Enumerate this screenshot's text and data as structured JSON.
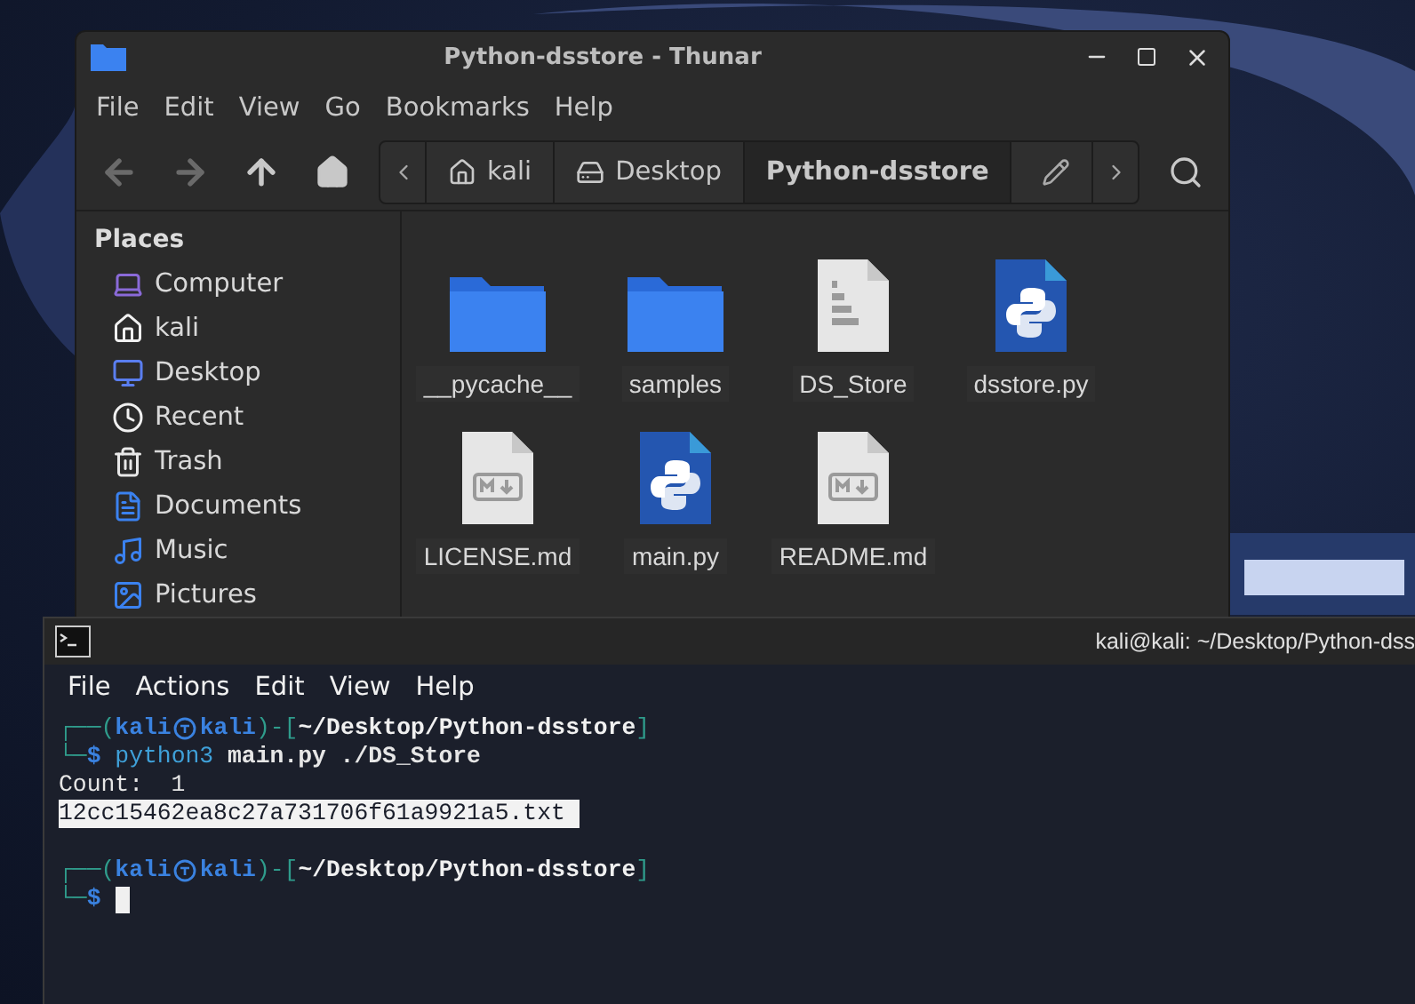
{
  "file_manager": {
    "title": "Python-dsstore - Thunar",
    "menu": [
      "File",
      "Edit",
      "View",
      "Go",
      "Bookmarks",
      "Help"
    ],
    "path": [
      {
        "label": "kali",
        "kind": "home",
        "selected": false
      },
      {
        "label": "Desktop",
        "kind": "desktop",
        "selected": false
      },
      {
        "label": "Python-dsstore",
        "kind": "folder",
        "selected": true
      }
    ],
    "sidebar": {
      "heading": "Places",
      "items": [
        {
          "label": "Computer",
          "kind": "computer"
        },
        {
          "label": "kali",
          "kind": "home"
        },
        {
          "label": "Desktop",
          "kind": "desktop"
        },
        {
          "label": "Recent",
          "kind": "recent"
        },
        {
          "label": "Trash",
          "kind": "trash"
        },
        {
          "label": "Documents",
          "kind": "documents"
        },
        {
          "label": "Music",
          "kind": "music"
        },
        {
          "label": "Pictures",
          "kind": "pictures"
        }
      ]
    },
    "files": [
      {
        "name": "__pycache__",
        "kind": "folder"
      },
      {
        "name": "samples",
        "kind": "folder"
      },
      {
        "name": "DS_Store",
        "kind": "binary"
      },
      {
        "name": "dsstore.py",
        "kind": "python"
      },
      {
        "name": "LICENSE.md",
        "kind": "markdown"
      },
      {
        "name": "main.py",
        "kind": "python"
      },
      {
        "name": "README.md",
        "kind": "markdown"
      }
    ]
  },
  "terminal": {
    "title": "kali@kali: ~/Desktop/Python-dss",
    "menu": [
      "File",
      "Actions",
      "Edit",
      "View",
      "Help"
    ],
    "lines": [
      {
        "kind": "prompt",
        "lead": "┌──(",
        "user": "kali",
        "host": "kali",
        "mid": ")-[",
        "dir": "~/Desktop/Python-dsstore",
        "close": "]",
        "prompt_lead": "└─$",
        "command": "python3",
        "args": "main.py ./DS_Store",
        "cursor": false
      },
      {
        "kind": "output",
        "text": "Count:  1"
      },
      {
        "kind": "selection",
        "text": "12cc15462ea8c27a731706f61a9921a5.txt "
      },
      {
        "kind": "blank"
      },
      {
        "kind": "prompt",
        "lead": "┌──(",
        "user": "kali",
        "host": "kali",
        "mid": ")-[",
        "dir": "~/Desktop/Python-dsstore",
        "close": "]",
        "prompt_lead": "└─$",
        "cursor": true
      }
    ]
  }
}
